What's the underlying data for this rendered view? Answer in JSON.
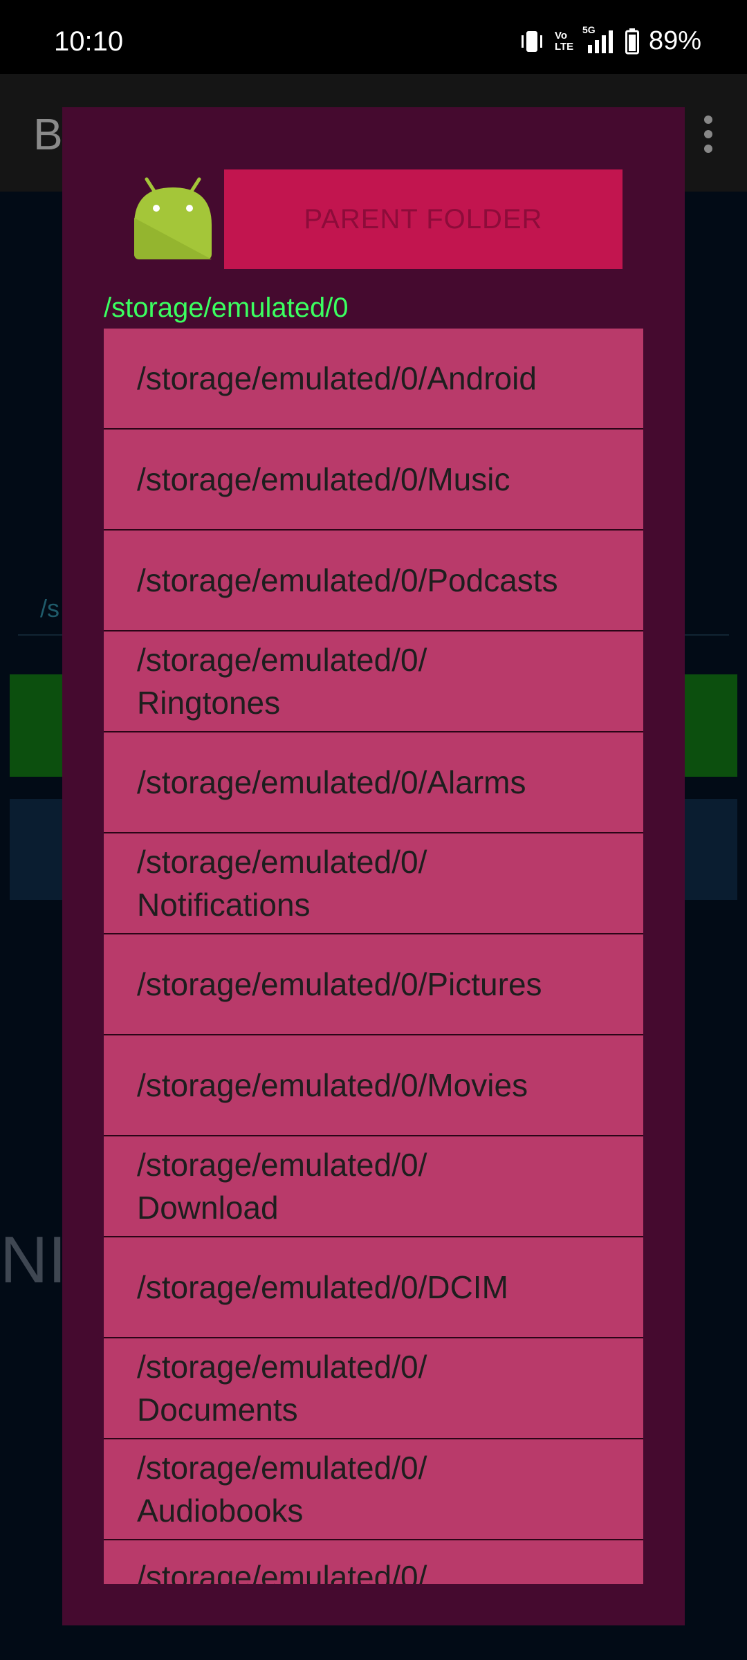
{
  "status_bar": {
    "time": "10:10",
    "network_5g": "5G",
    "volte": "Vo LTE",
    "battery": "89%"
  },
  "app": {
    "title": "B",
    "path_fragment": "/s",
    "big_text_fragment": "NI"
  },
  "dialog": {
    "parent_button_label": "PARENT FOLDER",
    "current_path": "/storage/emulated/0",
    "folders": [
      "/storage/emulated/0/Android",
      "/storage/emulated/0/Music",
      "/storage/emulated/0/Podcasts",
      "/storage/emulated/0/\nRingtones",
      "/storage/emulated/0/Alarms",
      "/storage/emulated/0/\nNotifications",
      "/storage/emulated/0/Pictures",
      "/storage/emulated/0/Movies",
      "/storage/emulated/0/\nDownload",
      "/storage/emulated/0/DCIM",
      "/storage/emulated/0/\nDocuments",
      "/storage/emulated/0/\nAudiobooks",
      "/storage/emulated/0/"
    ]
  },
  "colors": {
    "dialog_bg": "#450a2f",
    "button_bg": "#c2154f",
    "list_item_bg": "#b93a6a",
    "path_text": "#3bff60"
  },
  "icons": [
    "vibrate-icon",
    "volte-icon",
    "signal-5g-icon",
    "battery-icon",
    "android-app-icon",
    "overflow-menu-icon"
  ]
}
